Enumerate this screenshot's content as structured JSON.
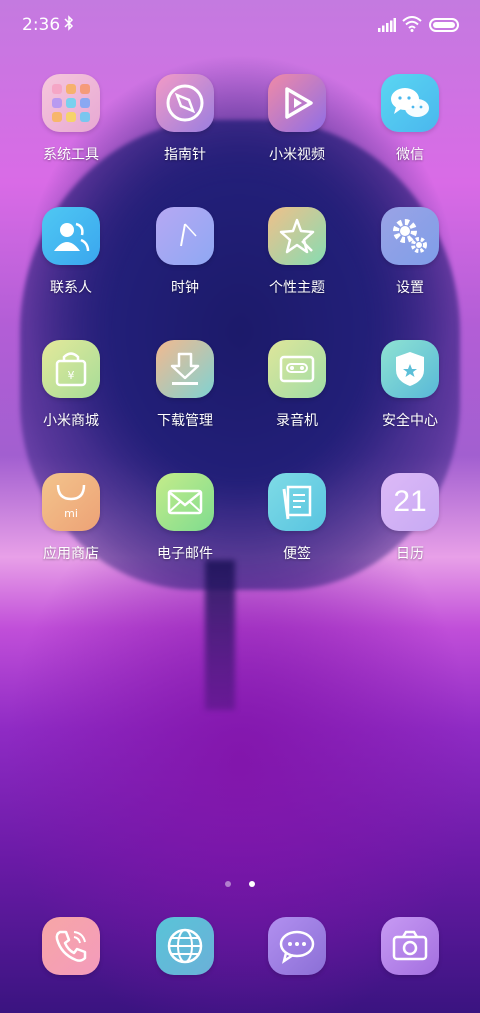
{
  "status": {
    "time": "2:36",
    "icons": [
      "bluetooth-icon",
      "signal-icon",
      "wifi-icon",
      "battery-icon"
    ]
  },
  "apps": [
    {
      "label": "系统工具",
      "icon": "folder-icon"
    },
    {
      "label": "指南针",
      "icon": "compass-icon"
    },
    {
      "label": "小米视频",
      "icon": "play-icon"
    },
    {
      "label": "微信",
      "icon": "wechat-icon"
    },
    {
      "label": "联系人",
      "icon": "contacts-icon"
    },
    {
      "label": "时钟",
      "icon": "clock-icon"
    },
    {
      "label": "个性主题",
      "icon": "theme-star-icon"
    },
    {
      "label": "设置",
      "icon": "gear-icon"
    },
    {
      "label": "小米商城",
      "icon": "shopping-bag-icon"
    },
    {
      "label": "下载管理",
      "icon": "download-icon"
    },
    {
      "label": "录音机",
      "icon": "cassette-icon"
    },
    {
      "label": "安全中心",
      "icon": "shield-icon"
    },
    {
      "label": "应用商店",
      "icon": "app-store-bag-icon"
    },
    {
      "label": "电子邮件",
      "icon": "mail-icon"
    },
    {
      "label": "便签",
      "icon": "notes-icon"
    },
    {
      "label": "日历",
      "icon": "calendar-icon",
      "value": "21"
    }
  ],
  "dock": [
    {
      "icon": "phone-icon"
    },
    {
      "icon": "browser-globe-icon"
    },
    {
      "icon": "messages-icon"
    },
    {
      "icon": "camera-icon"
    }
  ],
  "pages": {
    "count": 2,
    "current": 2
  },
  "colors": {
    "label": "#ffffff"
  }
}
